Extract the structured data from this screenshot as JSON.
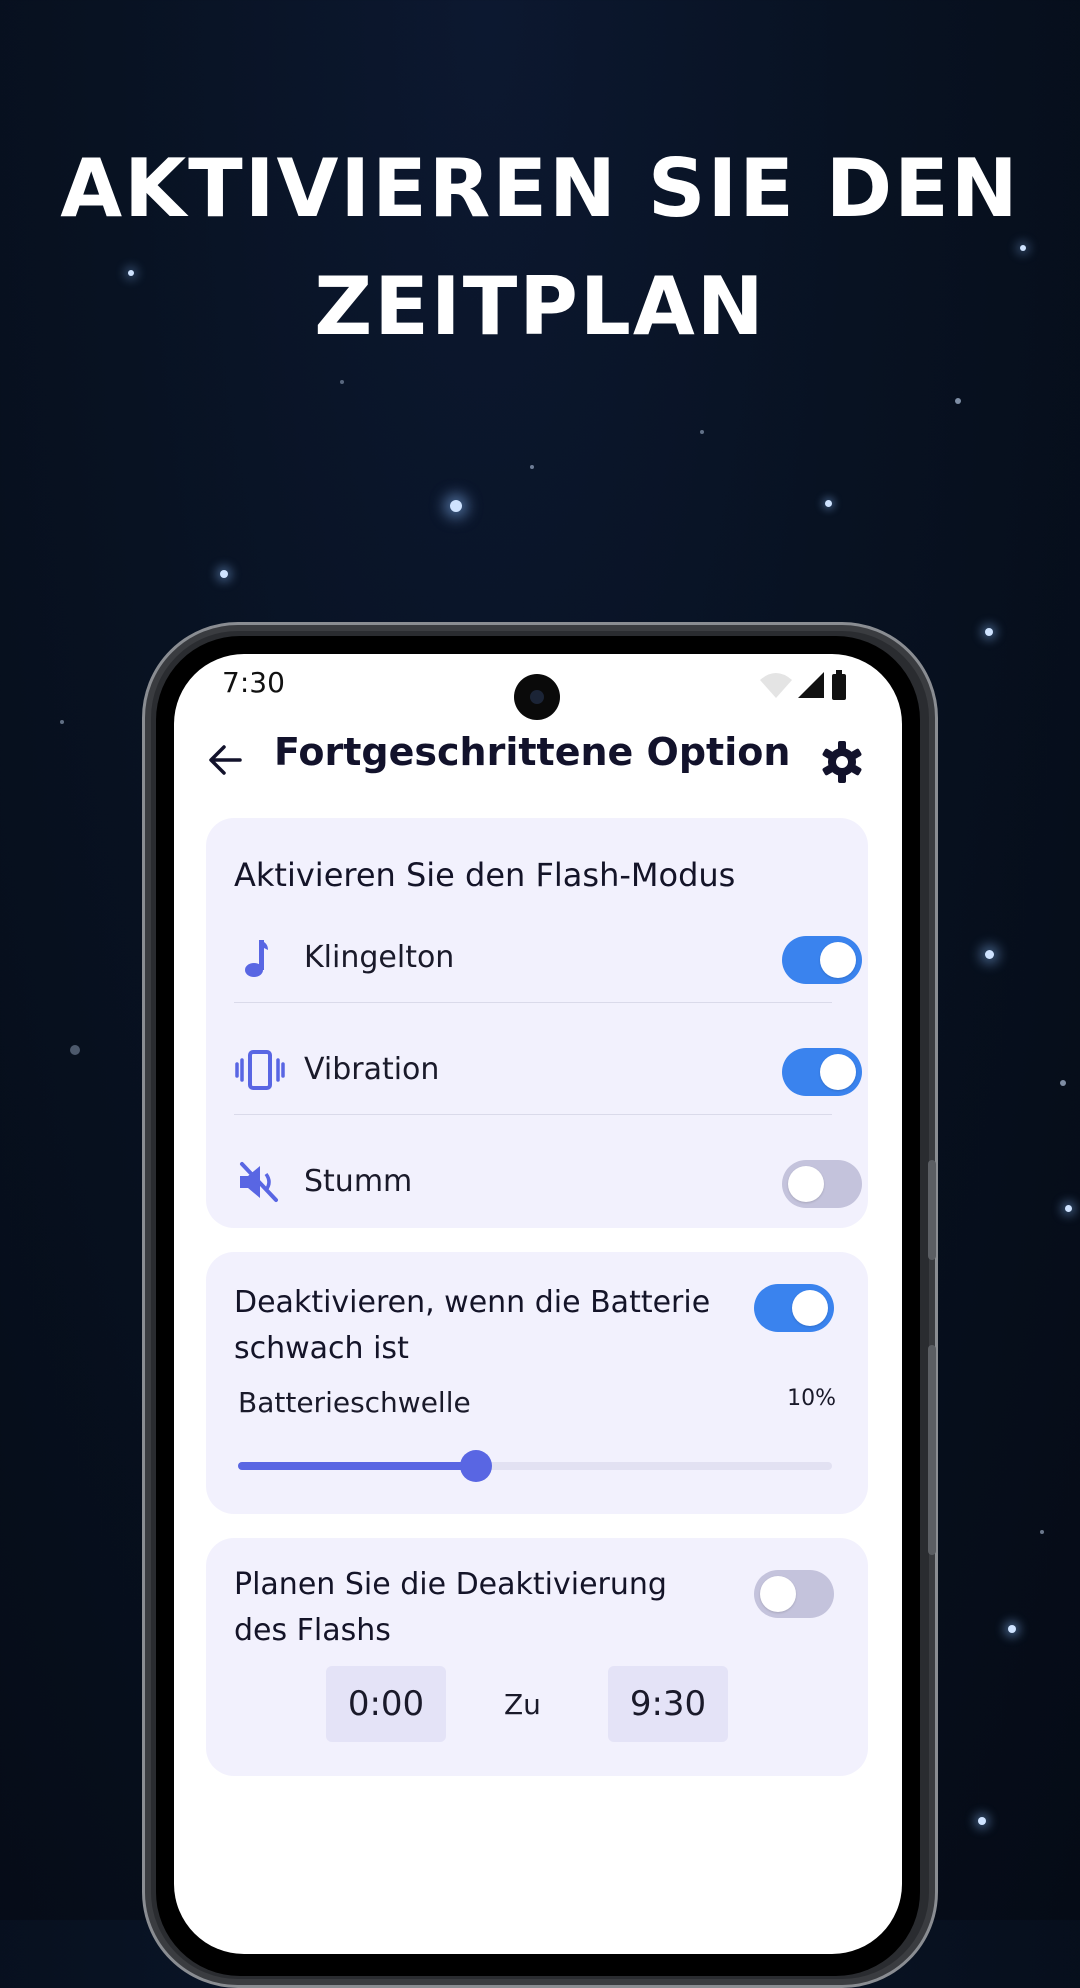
{
  "headline": {
    "line1": "AKTIVIEREN SIE DEN",
    "line2": "ZEITPLAN"
  },
  "status_bar": {
    "time": "7:30"
  },
  "appbar": {
    "title": "Fortgeschrittene Option",
    "back_icon": "arrow-left-icon",
    "settings_icon": "gear-icon"
  },
  "flash_mode": {
    "title": "Aktivieren Sie den Flash-Modus",
    "items": [
      {
        "label": "Klingelton",
        "icon": "music-note-icon",
        "enabled": true
      },
      {
        "label": "Vibration",
        "icon": "vibration-icon",
        "enabled": true
      },
      {
        "label": "Stumm",
        "icon": "mute-icon",
        "enabled": false
      }
    ]
  },
  "battery": {
    "title_line1": "Deaktivieren, wenn die Batterie",
    "title_line2": "schwach ist",
    "enabled": true,
    "threshold_label": "Batterieschwelle",
    "threshold_value": "10%",
    "slider_fraction": 0.4
  },
  "schedule": {
    "title_line1": "Planen Sie die Deaktivierung",
    "title_line2": "des Flashs",
    "enabled": false,
    "start_time": "0:00",
    "separator": "Zu",
    "end_time": "9:30"
  },
  "colors": {
    "accent": "#3a83ee",
    "icon": "#5966e3",
    "card_bg": "#f2f1fd",
    "title": "#12122b"
  }
}
